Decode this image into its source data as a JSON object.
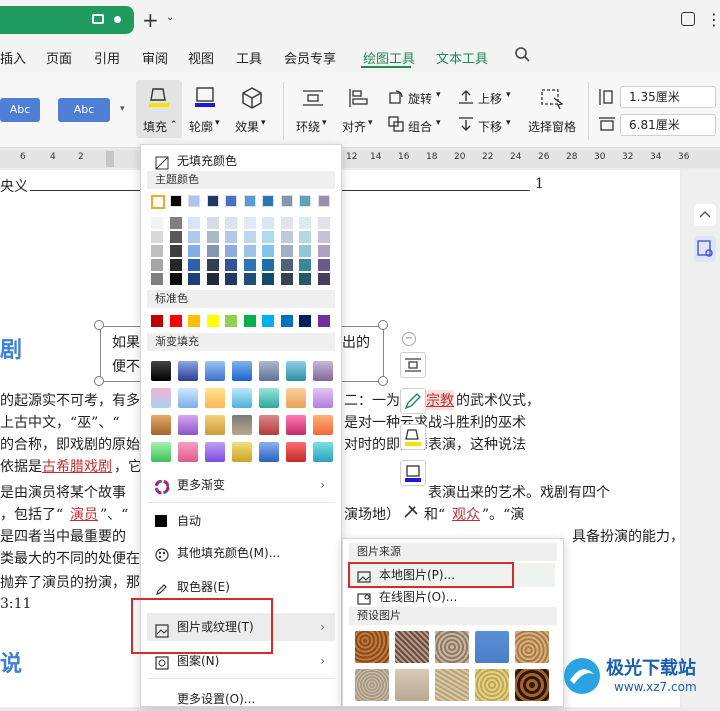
{
  "tabs": [
    "插入",
    "页面",
    "引用",
    "审阅",
    "视图",
    "工具",
    "会员专享",
    "绘图工具",
    "文本工具"
  ],
  "ribbon": {
    "style1": "Abc",
    "style2": "Abc",
    "fill": "填充",
    "outline": "轮廓",
    "effect": "效果",
    "wrap": "环绕",
    "align": "对齐",
    "rotate": "旋转",
    "group": "组合",
    "up": "上移",
    "down": "下移",
    "select_pane": "选择窗格",
    "height": "1.35厘米",
    "width": "6.81厘米"
  },
  "ruler": [
    "6",
    "4",
    "2",
    "2",
    "4",
    "6",
    "8",
    "10",
    "12",
    "14",
    "16",
    "18",
    "20",
    "22",
    "24",
    "26",
    "28",
    "30",
    "32",
    "34",
    "36",
    "38"
  ],
  "doc": {
    "line0a": "央义",
    "line0b": "1",
    "heading1": "剧",
    "box1": "如果",
    "box1b": "出的",
    "box2": "便不",
    "p1a": "的起源实不可考，有多",
    "p1b": "二：一为",
    "p1c": "宗教",
    "p1d": "的武术仪式，",
    "p2a": "上古中文，“巫”、“",
    "p2b": "是对一种云求战斗胜利的巫术",
    "p3a": "的合称，即戏剧的原始",
    "p3b": "对时的即兴舞表演，这种说法",
    "p4a": "依据是",
    "p4b": "古希腊戏剧",
    "p4c": "，它",
    "p5a": "是由演员将某个故事",
    "p5b": "表演出来的艺术。戏剧有四个",
    "p6a": "，包括了“",
    "p6b": "演员",
    "p6c": "”、“",
    "p6d": "演场地）",
    "p6e": "和“",
    "p6f": "观众",
    "p6g": "”。“演",
    "p7a": "是四者当中最重要的",
    "p7b": "具备扮演的能力，戏剧与其它",
    "p8a": "类最大的不同的处便在",
    "p9a": "抛弃了演员的扮演，那",
    "p10": "3:11",
    "heading2": "说"
  },
  "dropdown": {
    "no_fill": "无填充颜色",
    "theme_colors": "主题颜色",
    "standard_colors": "标准色",
    "gradient_fill": "渐变填充",
    "more_gradient": "更多渐变",
    "auto": "自动",
    "other_colors": "其他填充颜色(M)...",
    "eyedropper": "取色器(E)",
    "picture_texture": "图片或纹理(T)",
    "pattern": "图案(N)",
    "more_settings": "更多设置(O)..."
  },
  "submenu": {
    "source": "图片来源",
    "local": "本地图片(P)...",
    "online": "在线图片(O)...",
    "preset": "预设图片"
  },
  "watermark": {
    "name": "极光下载站",
    "url": "www.xz7.com"
  },
  "colors": {
    "accent": "#1f8a55",
    "highlight_red": "#d42b2b",
    "theme_top": [
      "#ffffff",
      "#000000",
      "#e7e6e6",
      "#44546a",
      "#4472c4",
      "#ed7d31",
      "#a5a5a5",
      "#ffc000",
      "#5b9bd5",
      "#70ad47"
    ],
    "standard": [
      "#c00000",
      "#ff0000",
      "#ffc000",
      "#ffff00",
      "#92d050",
      "#00b050",
      "#00b0f0",
      "#0070c0",
      "#002060",
      "#7030a0"
    ]
  }
}
